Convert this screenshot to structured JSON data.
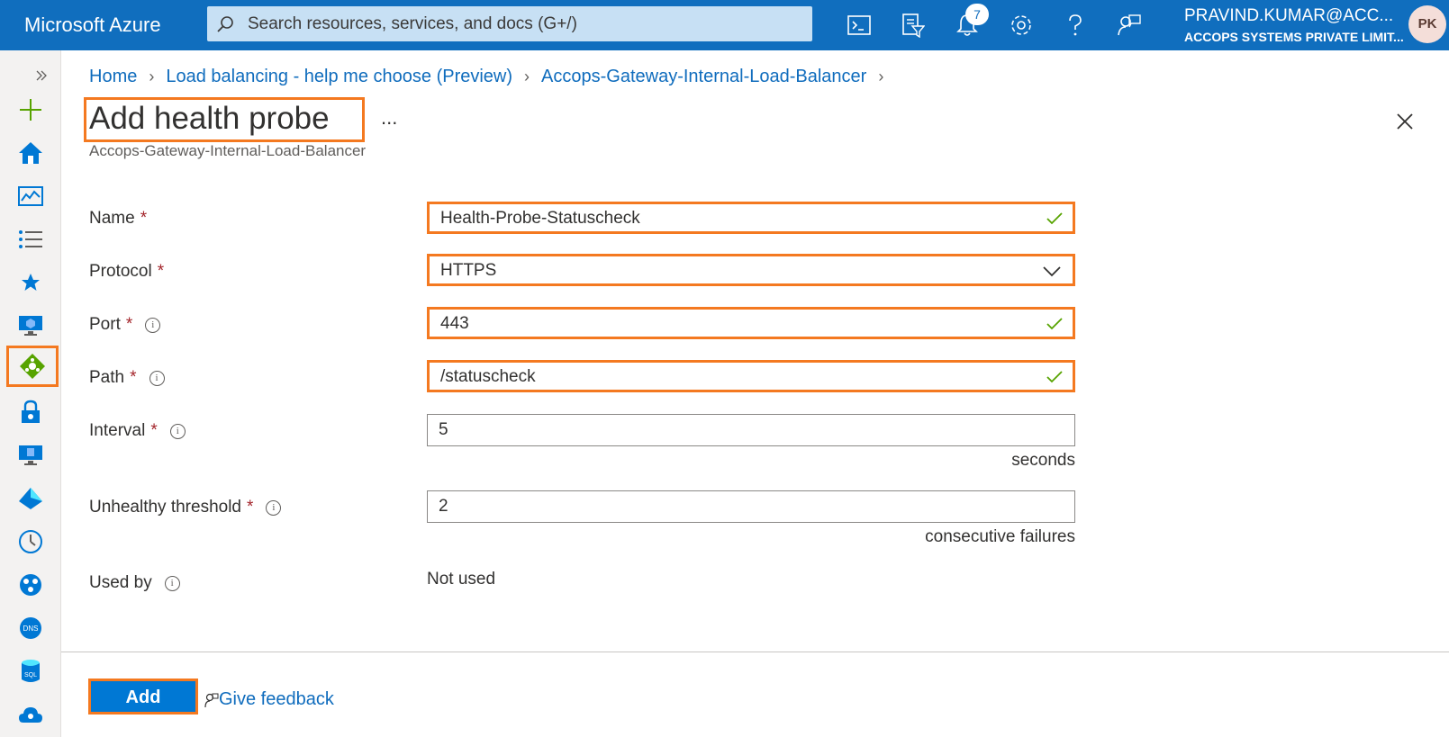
{
  "topbar": {
    "brand": "Microsoft Azure",
    "search_placeholder": "Search resources, services, and docs (G+/)",
    "notification_count": "7",
    "user_name": "PRAVIND.KUMAR@ACC...",
    "user_org": "ACCOPS SYSTEMS PRIVATE LIMIT...",
    "avatar_initials": "PK",
    "icons": [
      "cloud-shell-icon",
      "directory-filter-icon",
      "notifications-icon",
      "settings-icon",
      "help-icon",
      "feedback-icon"
    ]
  },
  "sidebar": {
    "items": [
      "expand-icon",
      "create-resource-icon",
      "home-icon",
      "dashboard-icon",
      "all-services-icon",
      "favorites-icon",
      "virtual-machines-icon",
      "load-balancer-icon",
      "key-vault-icon",
      "virtual-desktop-icon",
      "active-directory-icon",
      "monitor-icon",
      "network-icon",
      "dns-icon",
      "sql-icon",
      "cloud-services-icon"
    ]
  },
  "breadcrumb": {
    "items": [
      "Home",
      "Load balancing - help me choose (Preview)",
      "Accops-Gateway-Internal-Load-Balancer"
    ]
  },
  "page": {
    "title": "Add health probe",
    "subtitle": "Accops-Gateway-Internal-Load-Balancer",
    "more_label": "..."
  },
  "form": {
    "name": {
      "label": "Name",
      "required": "*",
      "value": "Health-Probe-Statuscheck"
    },
    "protocol": {
      "label": "Protocol",
      "required": "*",
      "value": "HTTPS"
    },
    "port": {
      "label": "Port",
      "required": "*",
      "value": "443"
    },
    "path": {
      "label": "Path",
      "required": "*",
      "value": "/statuscheck"
    },
    "interval": {
      "label": "Interval",
      "required": "*",
      "value": "5",
      "unit": "seconds"
    },
    "unhealthy": {
      "label": "Unhealthy threshold",
      "required": "*",
      "value": "2",
      "unit": "consecutive failures"
    },
    "used_by": {
      "label": "Used by",
      "value": "Not used"
    }
  },
  "footer": {
    "add_label": "Add",
    "feedback_label": "Give feedback"
  },
  "colors": {
    "accent": "#0078d4",
    "highlight": "#f47920",
    "success": "#57a300",
    "required": "#a4262c"
  }
}
